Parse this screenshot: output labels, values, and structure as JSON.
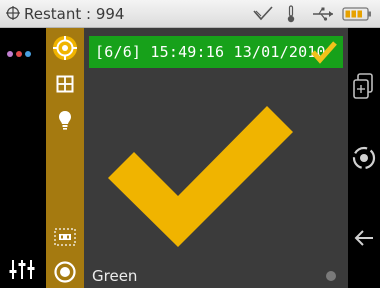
{
  "statusbar": {
    "title": "Restant : 994",
    "icons": [
      "crosshair-icon",
      "check-outline-icon",
      "thermometer-icon",
      "usb-icon",
      "battery-icon"
    ]
  },
  "tools": [
    "target-icon",
    "grid-icon",
    "lightbulb-icon",
    "film-icon",
    "record-icon"
  ],
  "left_strip": [
    "dots-icon",
    "sliders-icon"
  ],
  "result": {
    "text": "[6/6] 15:49:16 13/01/2010",
    "status": "pass"
  },
  "color_label": "Green",
  "right_buttons": [
    "export-icon",
    "rotate-icon",
    "back-icon"
  ],
  "colors": {
    "gold": "#a57a10",
    "check_yellow": "#f0b400",
    "banner_green": "#17a11a",
    "panel_gray": "#3b3b3b"
  }
}
